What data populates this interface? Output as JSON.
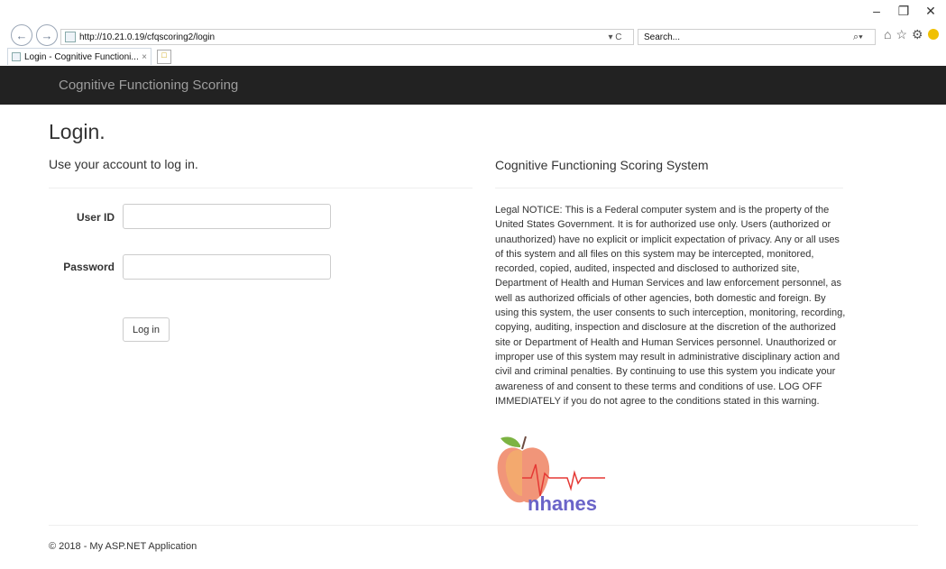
{
  "browser": {
    "url": "http://10.21.0.19/cfqscoring2/login",
    "search_placeholder": "Search...",
    "tab_title": "Login - Cognitive Functioni...",
    "tab_close": "×",
    "back_icon": "back-arrow-icon",
    "forward_icon": "forward-arrow-icon",
    "refresh_label": "▾ C",
    "window_controls": {
      "minimize": "–",
      "restore": "❐",
      "close": "✕"
    }
  },
  "navbar": {
    "brand": "Cognitive Functioning Scoring",
    "background": "#222222"
  },
  "login": {
    "title": "Login.",
    "subtitle": "Use your account to log in.",
    "user_id_label": "User ID",
    "password_label": "Password",
    "user_id_value": "",
    "password_value": "",
    "button_label": "Log in"
  },
  "info": {
    "heading": "Cognitive Functioning Scoring System",
    "notice": "Legal NOTICE: This is a Federal computer system and is the property of the United States Government. It is for authorized use only. Users (authorized or unauthorized) have no explicit or implicit expectation of privacy. Any or all uses of this system and all files on this system may be intercepted, monitored, recorded, copied, audited, inspected and disclosed to authorized site, Department of Health and Human Services and law enforcement personnel, as well as authorized officials of other agencies, both domestic and foreign. By using this system, the user consents to such interception, monitoring, recording, copying, auditing, inspection and disclosure at the discretion of the authorized site or Department of Health and Human Services personnel. Unauthorized or improper use of this system may result in administrative disciplinary action and civil and criminal penalties. By continuing to use this system you indicate your awareness of and consent to these terms and conditions of use. LOG OFF IMMEDIATELY if you do not agree to the conditions stated in this warning.",
    "logo_text": "nhanes"
  },
  "footer": {
    "text": "© 2018 - My ASP.NET Application"
  }
}
